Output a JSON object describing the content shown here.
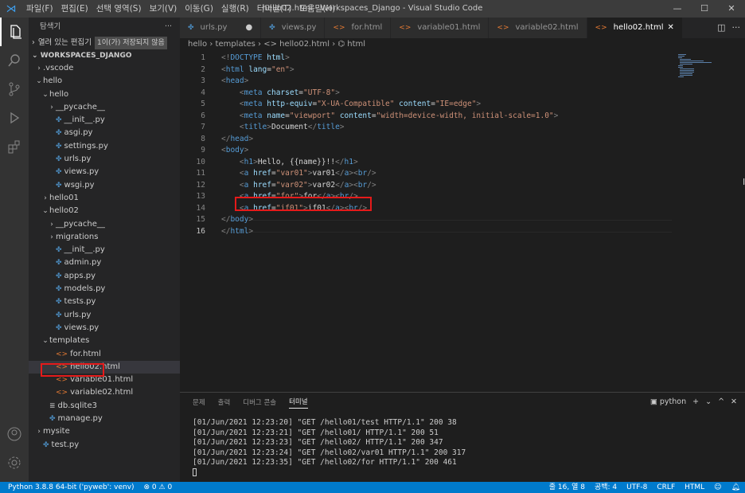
{
  "titlebar": {
    "menu": [
      "파일(F)",
      "편집(E)",
      "선택 영역(S)",
      "보기(V)",
      "이동(G)",
      "실행(R)",
      "터미널(T)",
      "도움말(H)"
    ],
    "title": "hello02.html - Workspaces_Django - Visual Studio Code"
  },
  "activity": [
    "explorer-icon",
    "search-icon",
    "source-control-icon",
    "run-debug-icon",
    "extensions-icon",
    "account-icon",
    "gear-icon"
  ],
  "sidebar": {
    "title": "탐색기",
    "more": "···",
    "open_editors": "열려 있는 편집기",
    "unsaved": "1이(가) 저장되지 않음",
    "workspace": "WORKSPACES_DJANGO"
  },
  "tree": [
    {
      "indent": 0,
      "tw": "›",
      "icon": "",
      "label": ".vscode"
    },
    {
      "indent": 0,
      "tw": "⌄",
      "icon": "",
      "label": "hello"
    },
    {
      "indent": 1,
      "tw": "⌄",
      "icon": "",
      "label": "hello"
    },
    {
      "indent": 2,
      "tw": "›",
      "icon": "",
      "label": "__pycache__"
    },
    {
      "indent": 2,
      "tw": "",
      "icon": "py",
      "label": "__init__.py"
    },
    {
      "indent": 2,
      "tw": "",
      "icon": "py",
      "label": "asgi.py"
    },
    {
      "indent": 2,
      "tw": "",
      "icon": "py",
      "label": "settings.py"
    },
    {
      "indent": 2,
      "tw": "",
      "icon": "py",
      "label": "urls.py"
    },
    {
      "indent": 2,
      "tw": "",
      "icon": "py",
      "label": "views.py"
    },
    {
      "indent": 2,
      "tw": "",
      "icon": "py",
      "label": "wsgi.py"
    },
    {
      "indent": 1,
      "tw": "›",
      "icon": "",
      "label": "hello01"
    },
    {
      "indent": 1,
      "tw": "⌄",
      "icon": "",
      "label": "hello02"
    },
    {
      "indent": 2,
      "tw": "›",
      "icon": "",
      "label": "__pycache__"
    },
    {
      "indent": 2,
      "tw": "›",
      "icon": "",
      "label": "migrations"
    },
    {
      "indent": 2,
      "tw": "",
      "icon": "py",
      "label": "__init__.py"
    },
    {
      "indent": 2,
      "tw": "",
      "icon": "py",
      "label": "admin.py"
    },
    {
      "indent": 2,
      "tw": "",
      "icon": "py",
      "label": "apps.py"
    },
    {
      "indent": 2,
      "tw": "",
      "icon": "py",
      "label": "models.py"
    },
    {
      "indent": 2,
      "tw": "",
      "icon": "py",
      "label": "tests.py"
    },
    {
      "indent": 2,
      "tw": "",
      "icon": "py",
      "label": "urls.py"
    },
    {
      "indent": 2,
      "tw": "",
      "icon": "py",
      "label": "views.py"
    },
    {
      "indent": 1,
      "tw": "⌄",
      "icon": "",
      "label": "templates"
    },
    {
      "indent": 2,
      "tw": "",
      "icon": "html",
      "label": "for.html"
    },
    {
      "indent": 2,
      "tw": "",
      "icon": "html",
      "label": "hello02.html",
      "selected": true
    },
    {
      "indent": 2,
      "tw": "",
      "icon": "html",
      "label": "variable01.html"
    },
    {
      "indent": 2,
      "tw": "",
      "icon": "html",
      "label": "variable02.html"
    },
    {
      "indent": 1,
      "tw": "",
      "icon": "db",
      "label": "db.sqlite3"
    },
    {
      "indent": 1,
      "tw": "",
      "icon": "py",
      "label": "manage.py"
    },
    {
      "indent": 0,
      "tw": "›",
      "icon": "",
      "label": "mysite"
    },
    {
      "indent": 0,
      "tw": "",
      "icon": "py",
      "label": "test.py"
    }
  ],
  "tabs": [
    {
      "icon": "py",
      "label": "urls.py",
      "dot": "●"
    },
    {
      "icon": "py",
      "label": "views.py"
    },
    {
      "icon": "html",
      "label": "for.html"
    },
    {
      "icon": "html",
      "label": "variable01.html"
    },
    {
      "icon": "html",
      "label": "variable02.html"
    },
    {
      "icon": "html",
      "label": "hello02.html",
      "active": true,
      "close": "✕"
    }
  ],
  "breadcrumb": "hello › templates › <> hello02.html › ⌬ html",
  "code": [
    [
      [
        "punc",
        "<!"
      ],
      [
        "tag",
        "DOCTYPE"
      ],
      [
        "txt",
        " "
      ],
      [
        "attr",
        "html"
      ],
      [
        "punc",
        ">"
      ]
    ],
    [
      [
        "punc",
        "<"
      ],
      [
        "tag",
        "html"
      ],
      [
        "txt",
        " "
      ],
      [
        "attr",
        "lang"
      ],
      [
        "txt",
        "="
      ],
      [
        "str",
        "\"en\""
      ],
      [
        "punc",
        ">"
      ]
    ],
    [
      [
        "punc",
        "<"
      ],
      [
        "tag",
        "head"
      ],
      [
        "punc",
        ">"
      ]
    ],
    [
      [
        "txt",
        "    "
      ],
      [
        "punc",
        "<"
      ],
      [
        "tag",
        "meta"
      ],
      [
        "txt",
        " "
      ],
      [
        "attr",
        "charset"
      ],
      [
        "txt",
        "="
      ],
      [
        "str",
        "\"UTF-8\""
      ],
      [
        "punc",
        ">"
      ]
    ],
    [
      [
        "txt",
        "    "
      ],
      [
        "punc",
        "<"
      ],
      [
        "tag",
        "meta"
      ],
      [
        "txt",
        " "
      ],
      [
        "attr",
        "http-equiv"
      ],
      [
        "txt",
        "="
      ],
      [
        "str",
        "\"X-UA-Compatible\""
      ],
      [
        "txt",
        " "
      ],
      [
        "attr",
        "content"
      ],
      [
        "txt",
        "="
      ],
      [
        "str",
        "\"IE=edge\""
      ],
      [
        "punc",
        ">"
      ]
    ],
    [
      [
        "txt",
        "    "
      ],
      [
        "punc",
        "<"
      ],
      [
        "tag",
        "meta"
      ],
      [
        "txt",
        " "
      ],
      [
        "attr",
        "name"
      ],
      [
        "txt",
        "="
      ],
      [
        "str",
        "\"viewport\""
      ],
      [
        "txt",
        " "
      ],
      [
        "attr",
        "content"
      ],
      [
        "txt",
        "="
      ],
      [
        "str",
        "\"width=device-width, initial-scale=1.0\""
      ],
      [
        "punc",
        ">"
      ]
    ],
    [
      [
        "txt",
        "    "
      ],
      [
        "punc",
        "<"
      ],
      [
        "tag",
        "title"
      ],
      [
        "punc",
        ">"
      ],
      [
        "txt",
        "Document"
      ],
      [
        "punc",
        "</"
      ],
      [
        "tag",
        "title"
      ],
      [
        "punc",
        ">"
      ]
    ],
    [
      [
        "punc",
        "</"
      ],
      [
        "tag",
        "head"
      ],
      [
        "punc",
        ">"
      ]
    ],
    [
      [
        "punc",
        "<"
      ],
      [
        "tag",
        "body"
      ],
      [
        "punc",
        ">"
      ]
    ],
    [
      [
        "txt",
        "    "
      ],
      [
        "punc",
        "<"
      ],
      [
        "tag",
        "h1"
      ],
      [
        "punc",
        ">"
      ],
      [
        "txt",
        "Hello, {{name}}!!"
      ],
      [
        "punc",
        "</"
      ],
      [
        "tag",
        "h1"
      ],
      [
        "punc",
        ">"
      ]
    ],
    [
      [
        "txt",
        "    "
      ],
      [
        "punc",
        "<"
      ],
      [
        "tag",
        "a"
      ],
      [
        "txt",
        " "
      ],
      [
        "attr",
        "href"
      ],
      [
        "txt",
        "="
      ],
      [
        "str",
        "\"var01\""
      ],
      [
        "punc",
        ">"
      ],
      [
        "txt",
        "var01"
      ],
      [
        "punc",
        "</"
      ],
      [
        "tag",
        "a"
      ],
      [
        "punc",
        "><"
      ],
      [
        "tag",
        "br"
      ],
      [
        "punc",
        "/>"
      ]
    ],
    [
      [
        "txt",
        "    "
      ],
      [
        "punc",
        "<"
      ],
      [
        "tag",
        "a"
      ],
      [
        "txt",
        " "
      ],
      [
        "attr",
        "href"
      ],
      [
        "txt",
        "="
      ],
      [
        "str",
        "\"var02\""
      ],
      [
        "punc",
        ">"
      ],
      [
        "txt",
        "var02"
      ],
      [
        "punc",
        "</"
      ],
      [
        "tag",
        "a"
      ],
      [
        "punc",
        "><"
      ],
      [
        "tag",
        "br"
      ],
      [
        "punc",
        "/>"
      ]
    ],
    [
      [
        "txt",
        "    "
      ],
      [
        "punc",
        "<"
      ],
      [
        "tag",
        "a"
      ],
      [
        "txt",
        " "
      ],
      [
        "attr",
        "href"
      ],
      [
        "txt",
        "="
      ],
      [
        "str",
        "\"for\""
      ],
      [
        "punc",
        ">"
      ],
      [
        "txt",
        "for"
      ],
      [
        "punc",
        "</"
      ],
      [
        "tag",
        "a"
      ],
      [
        "punc",
        "><"
      ],
      [
        "tag",
        "br"
      ],
      [
        "punc",
        "/>"
      ]
    ],
    [
      [
        "txt",
        "    "
      ],
      [
        "punc",
        "<"
      ],
      [
        "tag",
        "a"
      ],
      [
        "txt",
        " "
      ],
      [
        "attr",
        "href"
      ],
      [
        "txt",
        "="
      ],
      [
        "str",
        "\"if01\""
      ],
      [
        "punc",
        ">"
      ],
      [
        "txt",
        "if01"
      ],
      [
        "punc",
        "</"
      ],
      [
        "tag",
        "a"
      ],
      [
        "punc",
        "><"
      ],
      [
        "tag",
        "br"
      ],
      [
        "punc",
        "/>"
      ]
    ],
    [
      [
        "punc",
        "</"
      ],
      [
        "tag",
        "body"
      ],
      [
        "punc",
        ">"
      ]
    ],
    [
      [
        "punc",
        "</"
      ],
      [
        "tag",
        "html"
      ],
      [
        "punc",
        ">"
      ]
    ]
  ],
  "current_line": 16,
  "terminal": {
    "tabs": [
      "문제",
      "출력",
      "디버그 콘솔",
      "터미널"
    ],
    "active_tab": "터미널",
    "shell": "python",
    "actions": [
      "+",
      "⌄",
      "^",
      "✕"
    ],
    "lines": [
      "[01/Jun/2021 12:23:20] \"GET /hello01/test HTTP/1.1\" 200 38",
      "[01/Jun/2021 12:23:21] \"GET /hello01/ HTTP/1.1\" 200 51",
      "[01/Jun/2021 12:23:23] \"GET /hello02/ HTTP/1.1\" 200 347",
      "[01/Jun/2021 12:23:24] \"GET /hello02/var01 HTTP/1.1\" 200 317",
      "[01/Jun/2021 12:23:35] \"GET /hello02/for HTTP/1.1\" 200 461"
    ]
  },
  "status": {
    "python": "Python 3.8.8 64-bit ('pyweb': venv)",
    "problems": "⊗ 0 ⚠ 0",
    "position": "줄 16, 열 8",
    "spaces": "공백: 4",
    "encoding": "UTF-8",
    "eol": "CRLF",
    "language": "HTML"
  },
  "colors": {
    "accent": "#007acc",
    "highlight": "#e51a1a"
  }
}
